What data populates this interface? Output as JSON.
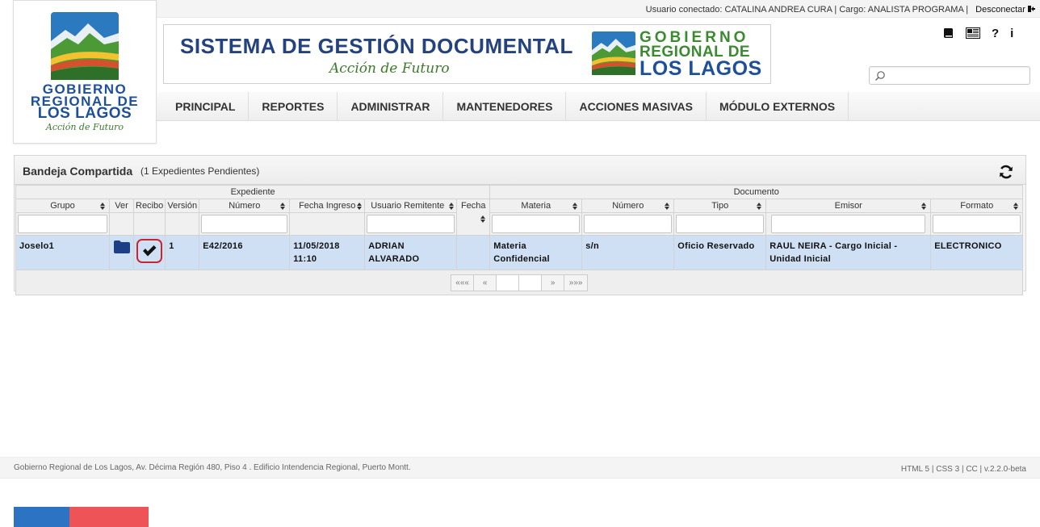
{
  "header": {
    "user_label": "Usuario conectado:",
    "user_name": "CATALINA ANDREA CURA",
    "role_label": "Cargo:",
    "role_name": "ANALISTA PROGRAMA",
    "logout": "Desconectar"
  },
  "logo": {
    "line1": "GOBIERNO",
    "line2": "REGIONAL DE",
    "line3": "LOS LAGOS",
    "tagline": "Acción de Futuro"
  },
  "banner": {
    "title": "SISTEMA DE GESTIÓN DOCUMENTAL",
    "subtitle": "Acción de Futuro",
    "line1": "GOBIERNO",
    "line2": "REGIONAL DE",
    "line3": "LOS LAGOS"
  },
  "tools": {
    "book": "book-icon",
    "news": "newspaper-icon",
    "help": "?",
    "info": "i"
  },
  "search": {
    "placeholder": ""
  },
  "nav": [
    "PRINCIPAL",
    "REPORTES",
    "ADMINISTRAR",
    "MANTENEDORES",
    "ACCIONES MASIVAS",
    "MÓDULO EXTERNOS"
  ],
  "panel": {
    "title": "Bandeja Compartida",
    "count": "(1 Expedientes Pendientes)"
  },
  "table": {
    "groups": [
      "Expediente",
      "Documento"
    ],
    "columns": [
      "Grupo",
      "Ver",
      "Recibo",
      "Versión",
      "Número",
      "Fecha Ingreso",
      "Usuario Remitente",
      "Fecha",
      "Materia",
      "Número",
      "Tipo",
      "Emisor",
      "Formato"
    ],
    "rows": [
      {
        "grupo": "Joselo1",
        "version": "1",
        "numero": "E42/2016",
        "fecha_ingreso": "11/05/2018 11:10",
        "usuario": "ADRIAN ALVARADO",
        "fecha": "",
        "materia": "Materia Confidencial",
        "doc_numero": "s/n",
        "tipo": "Oficio Reservado",
        "emisor": "RAUL NEIRA - Cargo Inicial - Unidad Inicial",
        "formato": "ELECTRONICO"
      }
    ]
  },
  "pager": {
    "first": "«««",
    "prev": "«",
    "next": "»",
    "last": "»»»"
  },
  "footer": {
    "address": "Gobierno Regional de Los Lagos, Av. Décima Región 480, Piso 4 . Edificio Intendencia Regional, Puerto Montt.",
    "tech": "HTML 5 | CSS 3 | CC | v.2.2.0-beta"
  },
  "colors": {
    "brand_blue": "#1e4f9a",
    "brand_green": "#3c8a2f",
    "row_highlight": "#cfe0f5",
    "stripe_blue": "#2d73c4",
    "stripe_red": "#ee5457"
  }
}
